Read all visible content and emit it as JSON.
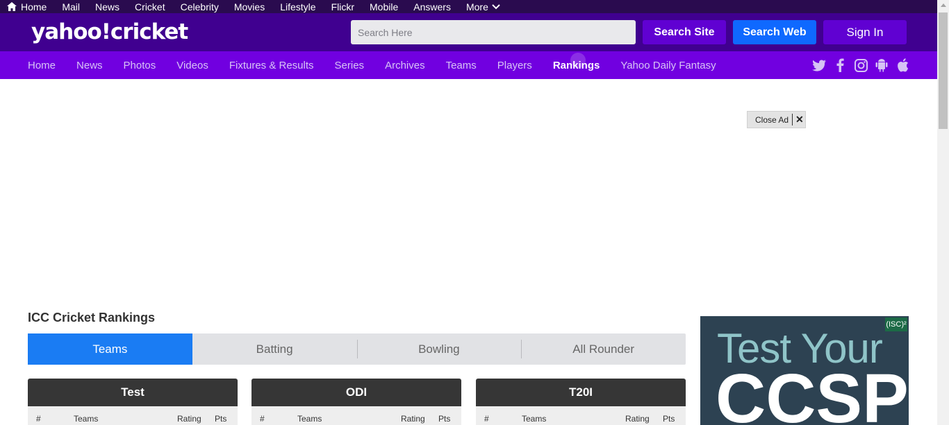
{
  "topbar": {
    "items": [
      "Home",
      "Mail",
      "News",
      "Cricket",
      "Celebrity",
      "Movies",
      "Lifestyle",
      "Flickr",
      "Mobile",
      "Answers"
    ],
    "more_label": "More"
  },
  "header": {
    "logo": "yahoo!cricket",
    "search_placeholder": "Search Here",
    "search_site_label": "Search Site",
    "search_web_label": "Search Web",
    "signin_label": "Sign In"
  },
  "nav": {
    "links": [
      "Home",
      "News",
      "Photos",
      "Videos",
      "Fixtures & Results",
      "Series",
      "Archives",
      "Teams",
      "Players",
      "Rankings",
      "Yahoo Daily Fantasy"
    ],
    "active": "Rankings",
    "social_icons": [
      "twitter-icon",
      "facebook-icon",
      "instagram-icon",
      "android-icon",
      "apple-icon"
    ]
  },
  "ad": {
    "close_label": "Close Ad",
    "close_symbol": "✕"
  },
  "rankings": {
    "title": "ICC Cricket Rankings",
    "tabs": [
      "Teams",
      "Batting",
      "Bowling",
      "All Rounder"
    ],
    "active_tab": "Teams",
    "cards": [
      {
        "format": "Test",
        "cols": [
          "#",
          "Teams",
          "Rating",
          "Pts"
        ]
      },
      {
        "format": "ODI",
        "cols": [
          "#",
          "Teams",
          "Rating",
          "Pts"
        ]
      },
      {
        "format": "T20I",
        "cols": [
          "#",
          "Teams",
          "Rating",
          "Pts"
        ]
      }
    ]
  },
  "side_ad": {
    "line1": "Test Your",
    "line2": "CCSP",
    "badge": "(ISC)²"
  },
  "colors": {
    "topbar": "#2a0b4f",
    "header": "#400090",
    "nav": "#7100e0",
    "active_tab": "#1a7cf3",
    "search_web": "#0f69ff"
  }
}
